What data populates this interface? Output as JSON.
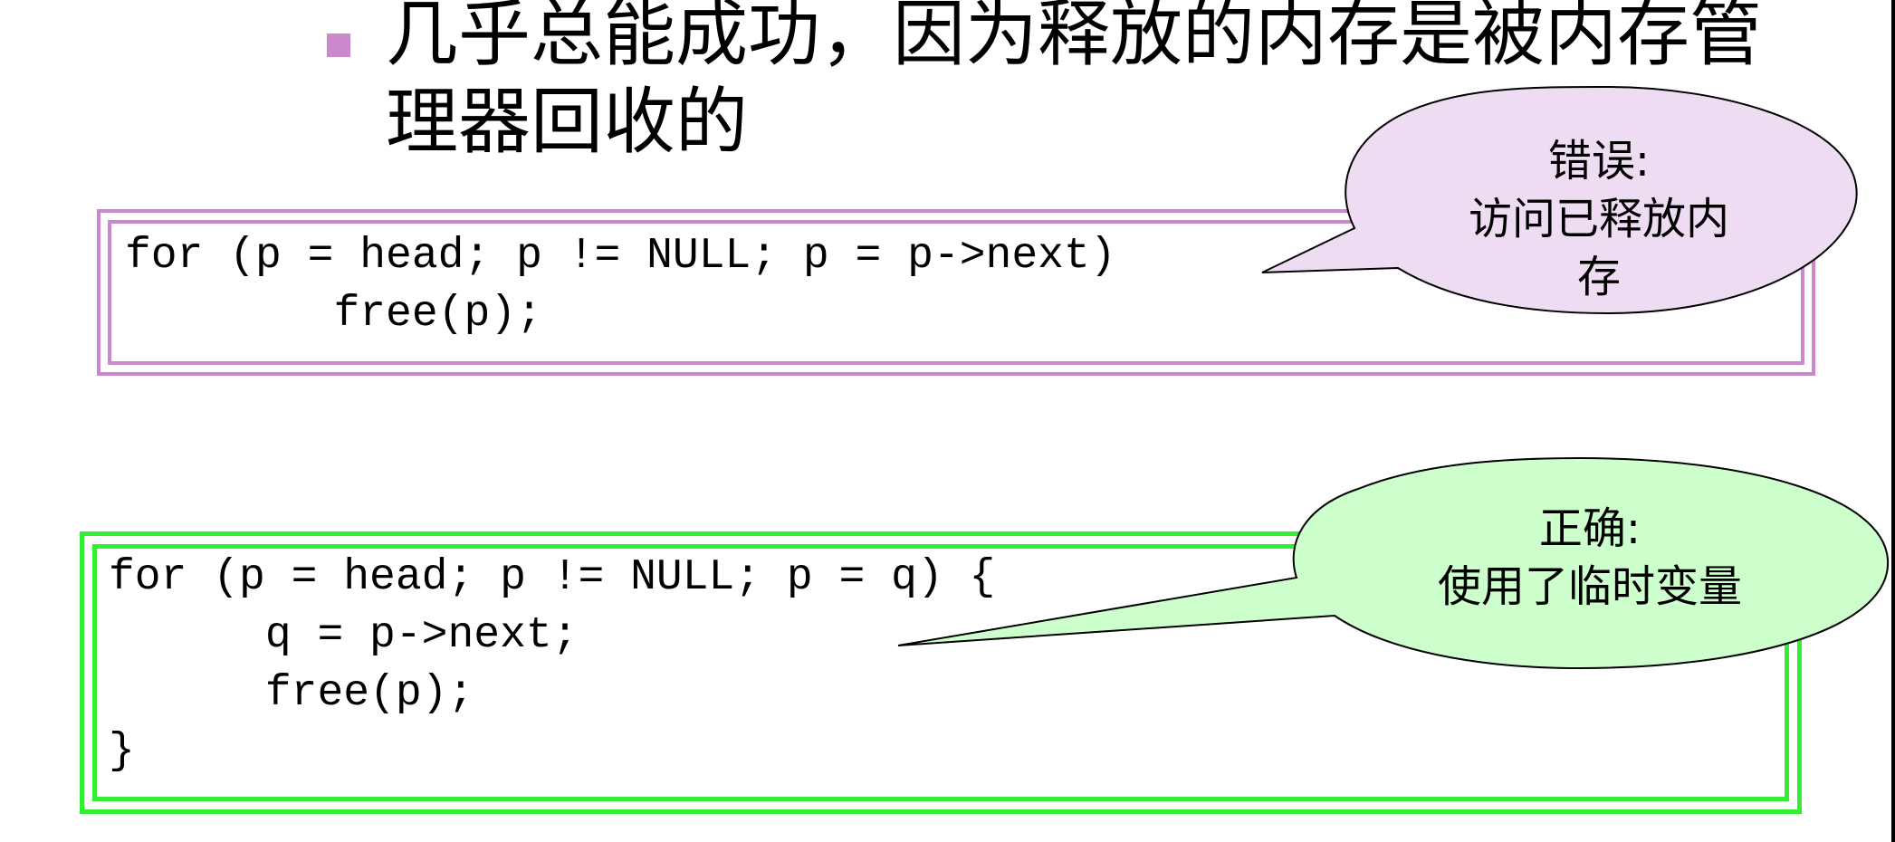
{
  "bullet": {
    "line1": "几乎总能成功，因为释放的内存是被内存管",
    "line2": "理器回收的",
    "marker_color": "#cc88cc"
  },
  "error_example": {
    "frame_color": "#cc88cc",
    "code_lines": [
      "for (p = head; p != NULL; p = p->next)",
      "        free(p);"
    ],
    "callout": {
      "line1": "错误:",
      "line2": "访问已释放内",
      "line3": "存",
      "fill_color": "#eeddf2"
    }
  },
  "correct_example": {
    "frame_color": "#33ee33",
    "code_lines": [
      "for (p = head; p != NULL; p = q) {",
      "      q = p->next;",
      "      free(p);",
      "}"
    ],
    "callout": {
      "line1": "正确:",
      "line2": "使用了临时变量",
      "fill_color": "#ccffcc"
    }
  }
}
